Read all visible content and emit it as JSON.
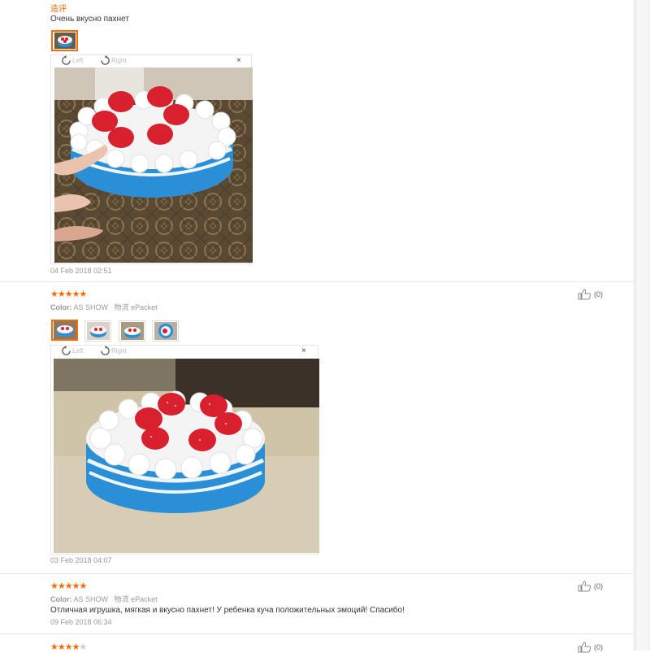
{
  "reviews": [
    {
      "name": "造评",
      "text": "Очень вкусно пахнет",
      "viewer": {
        "left_label": "Left",
        "right_label": "Right",
        "close": "×"
      },
      "date": "04 Feb 2018 02:51"
    },
    {
      "stars": "★★★★★",
      "color_label": "Color:",
      "color_value": "AS SHOW",
      "shipping_label": "物流",
      "shipping_value": "ePacket",
      "helpful_count": "(0)",
      "viewer": {
        "left_label": "Left",
        "right_label": "Right",
        "close": "×"
      },
      "date": "03 Feb 2018 04:07"
    },
    {
      "stars": "★★★★★",
      "color_label": "Color:",
      "color_value": "AS SHOW",
      "shipping_label": "物流",
      "shipping_value": "ePacket",
      "helpful_count": "(0)",
      "text": "Отличная игрушка, мягкая и вкусно пахнет! У ребенка куча положительных эмоций! Спасибо!",
      "date": "09 Feb 2018 06:34"
    },
    {
      "stars_full": "★★★★",
      "stars_empty": "★",
      "helpful_count": "(0)"
    }
  ],
  "icons": {
    "thumbs_up": "thumbs-up-icon",
    "rotate_left": "rotate-left-icon",
    "rotate_right": "rotate-right-icon",
    "close": "close-icon"
  },
  "colors": {
    "accent": "#ff6a00",
    "cake_blue": "#2a8fd6",
    "strawberry": "#d8202f"
  }
}
